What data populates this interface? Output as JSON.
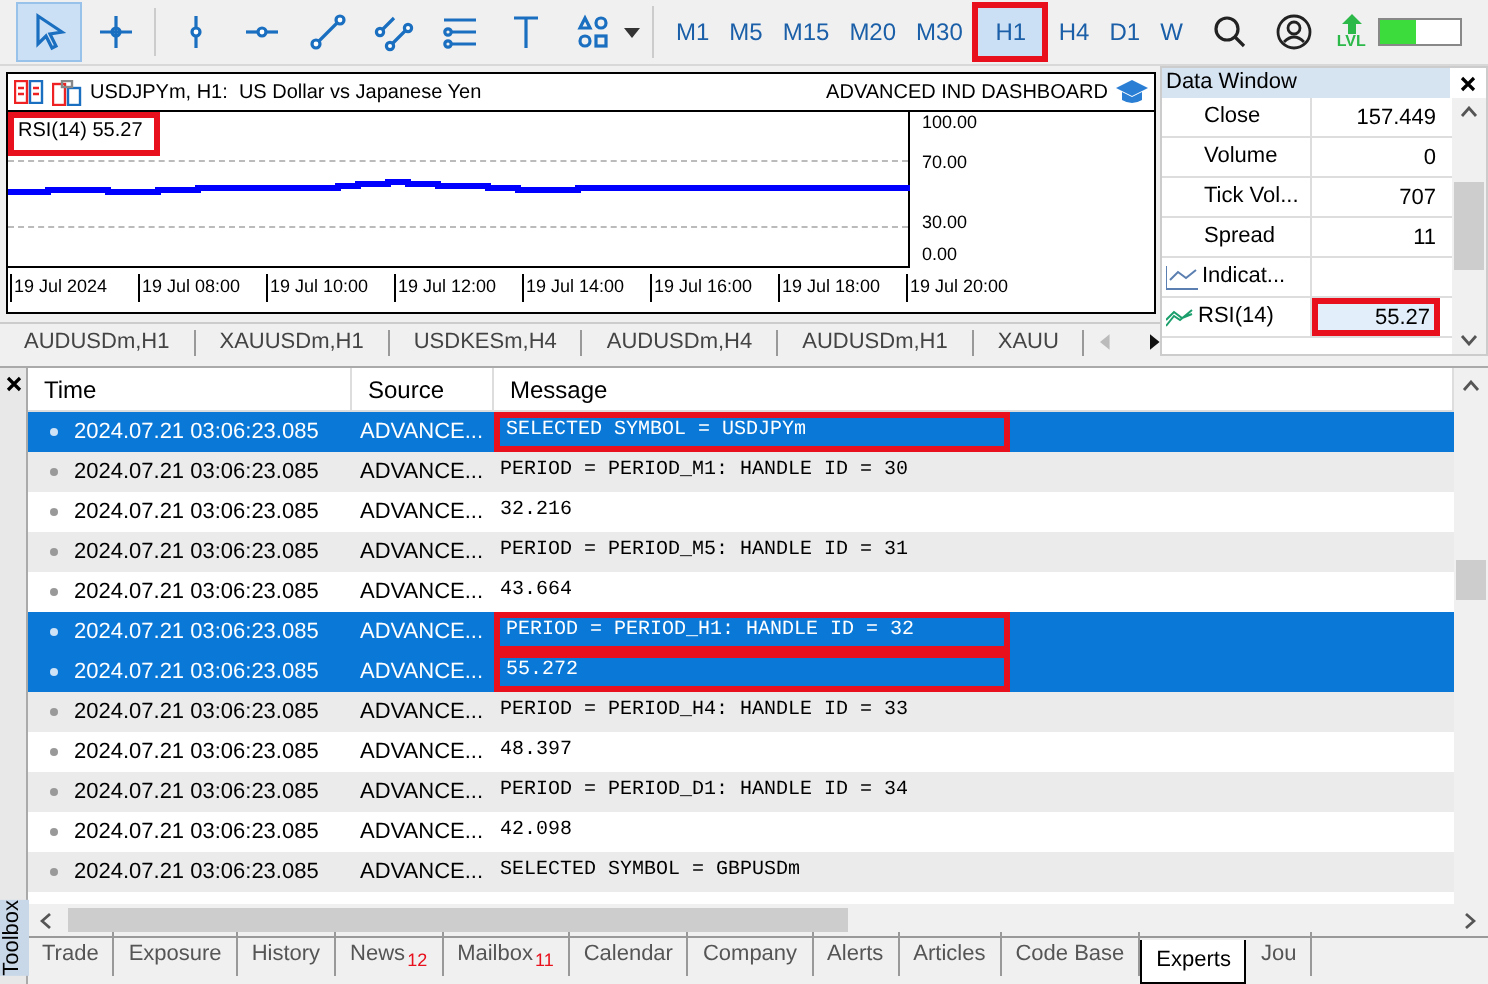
{
  "toolbar": {
    "timeframes": [
      {
        "label": "M1",
        "selected": false
      },
      {
        "label": "M5",
        "selected": false
      },
      {
        "label": "M15",
        "selected": false
      },
      {
        "label": "M20",
        "selected": false
      },
      {
        "label": "M30",
        "selected": false
      },
      {
        "label": "H1",
        "selected": true,
        "highlighted": true
      },
      {
        "label": "H4",
        "selected": false
      },
      {
        "label": "D1",
        "selected": false
      },
      {
        "label": "W",
        "selected": false
      }
    ],
    "lvl_label": "LVL",
    "meter": {
      "level": 0.45
    }
  },
  "chart": {
    "title": "USDJPYm, H1:  US Dollar vs Japanese Yen",
    "indicator_name": "ADVANCED IND DASHBOARD",
    "rsi_label": "RSI(14) 55.27",
    "rsi_highlighted": true,
    "y_labels": [
      "100.00",
      "70.00",
      "30.00",
      "0.00"
    ],
    "x_labels": [
      "19 Jul 2024",
      "19 Jul 08:00",
      "19 Jul 10:00",
      "19 Jul 12:00",
      "19 Jul 14:00",
      "19 Jul 16:00",
      "19 Jul 18:00",
      "19 Jul 20:00"
    ]
  },
  "chart_tabs": [
    "AUDUSDm,H1",
    "XAUUSDm,H1",
    "USDKESm,H4",
    "AUDUSDm,H4",
    "AUDUSDm,H1",
    "XAUU"
  ],
  "data_window": {
    "title": "Data Window",
    "rows": [
      {
        "kind": "field",
        "label": "Close",
        "value": "157.449"
      },
      {
        "kind": "field",
        "label": "Volume",
        "value": "0"
      },
      {
        "kind": "field",
        "label": "Tick Vol...",
        "value": "707"
      },
      {
        "kind": "field",
        "label": "Spread",
        "value": "11"
      },
      {
        "kind": "group",
        "label": "Indicat..."
      },
      {
        "kind": "indicator",
        "label": "RSI(14)",
        "value": "55.27",
        "highlighted": true
      }
    ]
  },
  "journal": {
    "columns": [
      "Time",
      "Source",
      "Message"
    ],
    "rows": [
      {
        "time": "2024.07.21 03:06:23.085",
        "source": "ADVANCE...",
        "message": "SELECTED SYMBOL = USDJPYm",
        "selected": true,
        "highlighted": true
      },
      {
        "time": "2024.07.21 03:06:23.085",
        "source": "ADVANCE...",
        "message": "PERIOD = PERIOD_M1: HANDLE ID = 30",
        "selected": false,
        "highlighted": false
      },
      {
        "time": "2024.07.21 03:06:23.085",
        "source": "ADVANCE...",
        "message": "32.216",
        "selected": false,
        "highlighted": false
      },
      {
        "time": "2024.07.21 03:06:23.085",
        "source": "ADVANCE...",
        "message": "PERIOD = PERIOD_M5: HANDLE ID = 31",
        "selected": false,
        "highlighted": false
      },
      {
        "time": "2024.07.21 03:06:23.085",
        "source": "ADVANCE...",
        "message": "43.664",
        "selected": false,
        "highlighted": false
      },
      {
        "time": "2024.07.21 03:06:23.085",
        "source": "ADVANCE...",
        "message": "PERIOD = PERIOD_H1: HANDLE ID = 32",
        "selected": true,
        "highlighted": true
      },
      {
        "time": "2024.07.21 03:06:23.085",
        "source": "ADVANCE...",
        "message": "55.272",
        "selected": true,
        "highlighted": true
      },
      {
        "time": "2024.07.21 03:06:23.085",
        "source": "ADVANCE...",
        "message": "PERIOD = PERIOD_H4: HANDLE ID = 33",
        "selected": false,
        "highlighted": false
      },
      {
        "time": "2024.07.21 03:06:23.085",
        "source": "ADVANCE...",
        "message": "48.397",
        "selected": false,
        "highlighted": false
      },
      {
        "time": "2024.07.21 03:06:23.085",
        "source": "ADVANCE...",
        "message": "PERIOD = PERIOD_D1: HANDLE ID = 34",
        "selected": false,
        "highlighted": false
      },
      {
        "time": "2024.07.21 03:06:23.085",
        "source": "ADVANCE...",
        "message": "42.098",
        "selected": false,
        "highlighted": false
      },
      {
        "time": "2024.07.21 03:06:23.085",
        "source": "ADVANCE...",
        "message": "SELECTED SYMBOL = GBPUSDm",
        "selected": false,
        "highlighted": false
      }
    ]
  },
  "toolbox_label": "Toolbox",
  "bottom_tabs": [
    {
      "label": "Trade",
      "selected": false
    },
    {
      "label": "Exposure",
      "selected": false
    },
    {
      "label": "History",
      "selected": false
    },
    {
      "label": "News",
      "badge": "12",
      "selected": false
    },
    {
      "label": "Mailbox",
      "badge": "11",
      "selected": false
    },
    {
      "label": "Calendar",
      "selected": false
    },
    {
      "label": "Company",
      "selected": false
    },
    {
      "label": "Alerts",
      "selected": false
    },
    {
      "label": "Articles",
      "selected": false
    },
    {
      "label": "Code Base",
      "selected": false
    },
    {
      "label": "Experts",
      "selected": true
    },
    {
      "label": "Jou",
      "selected": false
    }
  ]
}
